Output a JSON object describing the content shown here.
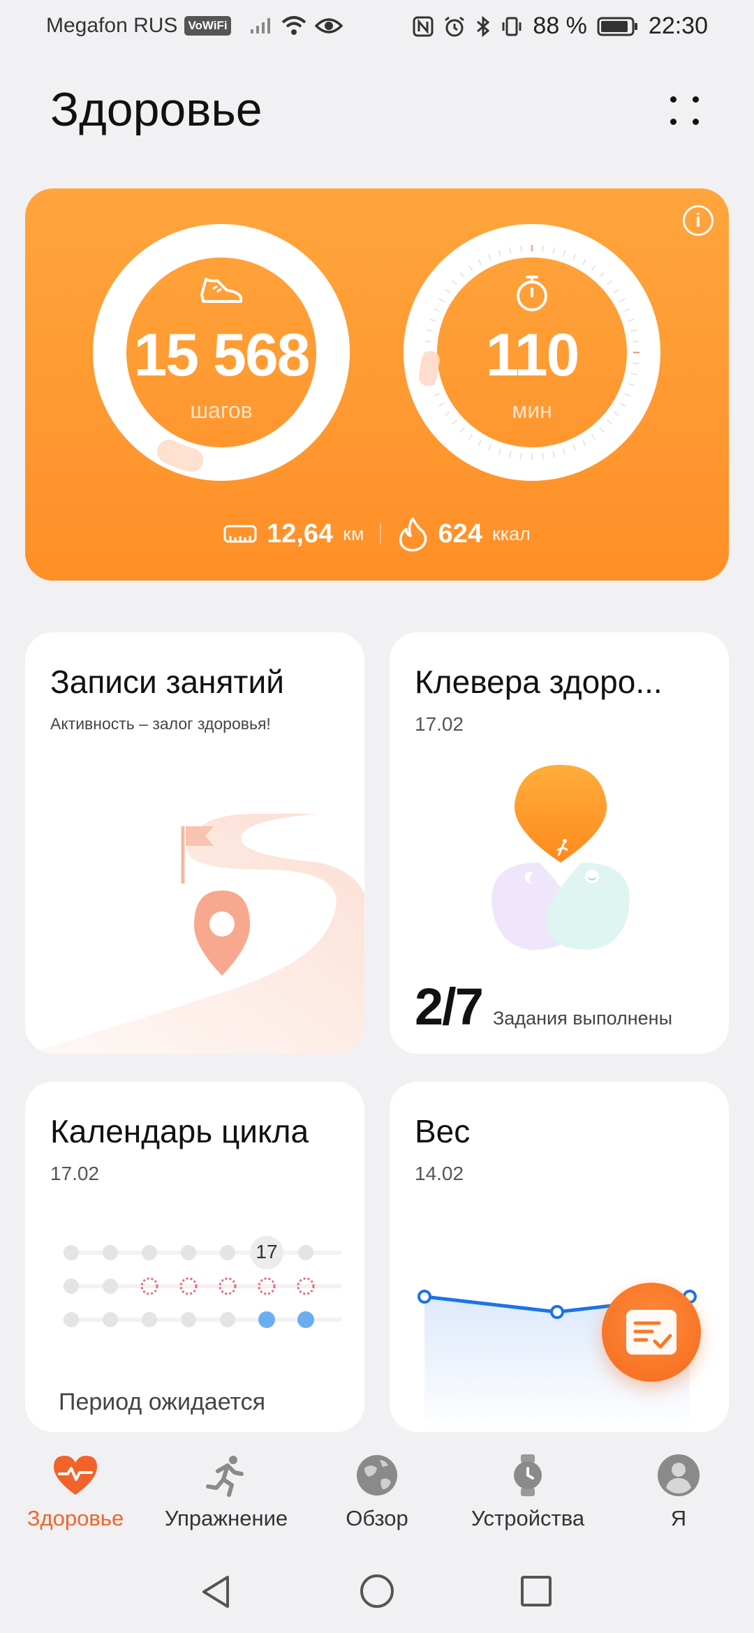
{
  "status_bar": {
    "carrier": "Megafon RUS",
    "vowifi": "VoWiFi",
    "battery": "88 %",
    "time": "22:30"
  },
  "header": {
    "title": "Здоровье"
  },
  "activity": {
    "steps_value": "15 568",
    "steps_unit": "шагов",
    "minutes_value": "110",
    "minutes_unit": "мин",
    "distance_value": "12,64",
    "distance_unit": "км",
    "calories_value": "624",
    "calories_unit": "ккал"
  },
  "cards": {
    "workouts": {
      "title": "Записи занятий",
      "subtitle": "Активность – залог здоровья!"
    },
    "clover": {
      "title": "Клевера здоро...",
      "date": "17.02",
      "progress": "2/7",
      "progress_label": "Задания выполнены"
    },
    "cycle": {
      "title": "Календарь цикла",
      "date": "17.02",
      "highlight_day": "17",
      "status_text": "Период ожидается"
    },
    "weight": {
      "title": "Вес",
      "date": "14.02"
    }
  },
  "bottom_nav": [
    {
      "label": "Здоровье"
    },
    {
      "label": "Упражнение"
    },
    {
      "label": "Обзор"
    },
    {
      "label": "Устройства"
    },
    {
      "label": "Я"
    }
  ],
  "colors": {
    "accent": "#f2632c",
    "activity_orange": "#ff9a30",
    "weight_line": "#1a73e8"
  }
}
